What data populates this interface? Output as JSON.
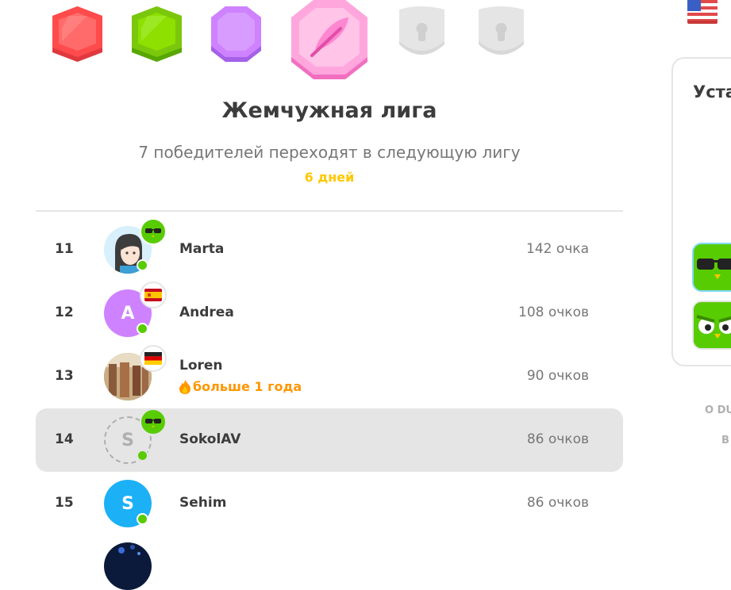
{
  "league": {
    "title": "Жемчужная лига",
    "subtitle": "7 победителей переходят в следующую лигу",
    "days_left": "6 дней",
    "badges": [
      {
        "name": "red-league-badge",
        "color": "#ff4b4b",
        "state": "unlocked"
      },
      {
        "name": "green-league-badge",
        "color": "#7ac70c",
        "state": "unlocked"
      },
      {
        "name": "purple-league-badge",
        "color": "#ce82ff",
        "state": "unlocked"
      },
      {
        "name": "pearl-league-badge",
        "color": "#ff86d0",
        "state": "current"
      },
      {
        "name": "locked-league-badge",
        "color": "#e5e5e5",
        "state": "locked"
      },
      {
        "name": "locked-league-badge",
        "color": "#e5e5e5",
        "state": "locked"
      }
    ]
  },
  "leaderboard": [
    {
      "rank": "11",
      "name": "Marta",
      "points": "142 очка",
      "avatar": "illustrated",
      "tag": "owl-sunglasses",
      "online": true
    },
    {
      "rank": "12",
      "name": "Andrea",
      "points": "108 очков",
      "avatar_letter": "A",
      "avatar_color": "#ce82ff",
      "tag": "flag-spain",
      "online": true
    },
    {
      "rank": "13",
      "name": "Loren",
      "streak": "больше 1 года",
      "points": "90 очков",
      "avatar": "photo",
      "tag": "flag-germany",
      "online": false
    },
    {
      "rank": "14",
      "name": "SokolAV",
      "points": "86 очков",
      "avatar_letter": "S",
      "avatar_style": "dashed",
      "tag": "owl-sunglasses",
      "online": true,
      "current_user": true
    },
    {
      "rank": "15",
      "name": "Sehim",
      "points": "86 очков",
      "avatar_letter": "S",
      "avatar_color": "#1cb0f6",
      "online": true
    }
  ],
  "side_panel": {
    "title": "Уста",
    "footer_line1": "О DU",
    "footer_line2": "В"
  },
  "colors": {
    "accent_green": "#58cc02",
    "days_yellow": "#ffc800",
    "streak_orange": "#ff9600",
    "current_row_bg": "#e5e5e5"
  }
}
